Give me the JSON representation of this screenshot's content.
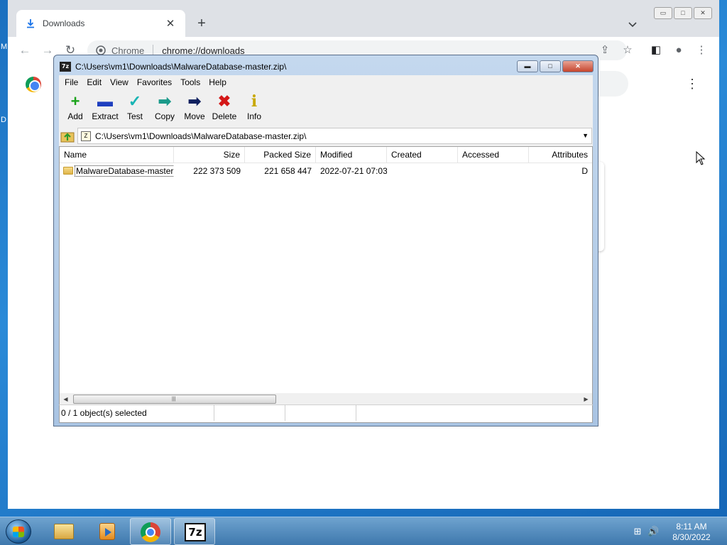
{
  "desktop": {
    "side_letters": [
      "M",
      "D"
    ]
  },
  "chrome": {
    "tab": {
      "title": "Downloads",
      "close": "✕"
    },
    "new_tab": "+",
    "tab_search": "⌄",
    "window_buttons": [
      "▭",
      "□",
      "✕"
    ],
    "nav": {
      "back": "←",
      "forward": "→",
      "reload": "↻"
    },
    "omnibox": {
      "chip": "Chrome",
      "url": "chrome://downloads"
    },
    "toolbar_icons": {
      "share": "⇪",
      "bookmark": "☆",
      "side_panel": "◧",
      "profile": "●",
      "menu": "⋮"
    },
    "page_menu": "⋮"
  },
  "sevenzip": {
    "app_icon": "7z",
    "title": "C:\\Users\\vm1\\Downloads\\MalwareDatabase-master.zip\\",
    "controls": {
      "minimize": "▬",
      "maximize": "□",
      "close": "✕"
    },
    "menu": [
      "File",
      "Edit",
      "View",
      "Favorites",
      "Tools",
      "Help"
    ],
    "toolbar": [
      {
        "label": "Add",
        "icon": "+",
        "color": "#1aa31a"
      },
      {
        "label": "Extract",
        "icon": "▬",
        "color": "#1f3fbf"
      },
      {
        "label": "Test",
        "icon": "✓",
        "color": "#18b4b4"
      },
      {
        "label": "Copy",
        "icon": "➡",
        "color": "#1a9a8a"
      },
      {
        "label": "Move",
        "icon": "➡",
        "color": "#10205f"
      },
      {
        "label": "Delete",
        "icon": "✖",
        "color": "#d41818"
      },
      {
        "label": "Info",
        "icon": "i",
        "color": "#c8a800"
      }
    ],
    "address": {
      "path": "C:\\Users\\vm1\\Downloads\\MalwareDatabase-master.zip\\",
      "dropdown": "▼"
    },
    "columns": [
      "Name",
      "Size",
      "Packed Size",
      "Modified",
      "Created",
      "Accessed",
      "Attributes"
    ],
    "rows": [
      {
        "name": "MalwareDatabase-master",
        "size": "222 373 509",
        "packed_size": "221 658 447",
        "modified": "2022-07-21 07:03",
        "created": "",
        "accessed": "",
        "attributes": "D"
      }
    ],
    "scroll": {
      "left": "◀",
      "right": "▶",
      "grip": "|||"
    },
    "status": {
      "selection": "0 / 1 object(s) selected"
    }
  },
  "taskbar": {
    "apps": [
      "Windows Explorer",
      "Windows Media Player",
      "Google Chrome",
      "7-Zip File Manager"
    ],
    "sevenzip_icon_text": "7z",
    "tray": {
      "network": "⊞",
      "volume": "🔊"
    },
    "clock": {
      "time": "8:11 AM",
      "date": "8/30/2022"
    }
  }
}
